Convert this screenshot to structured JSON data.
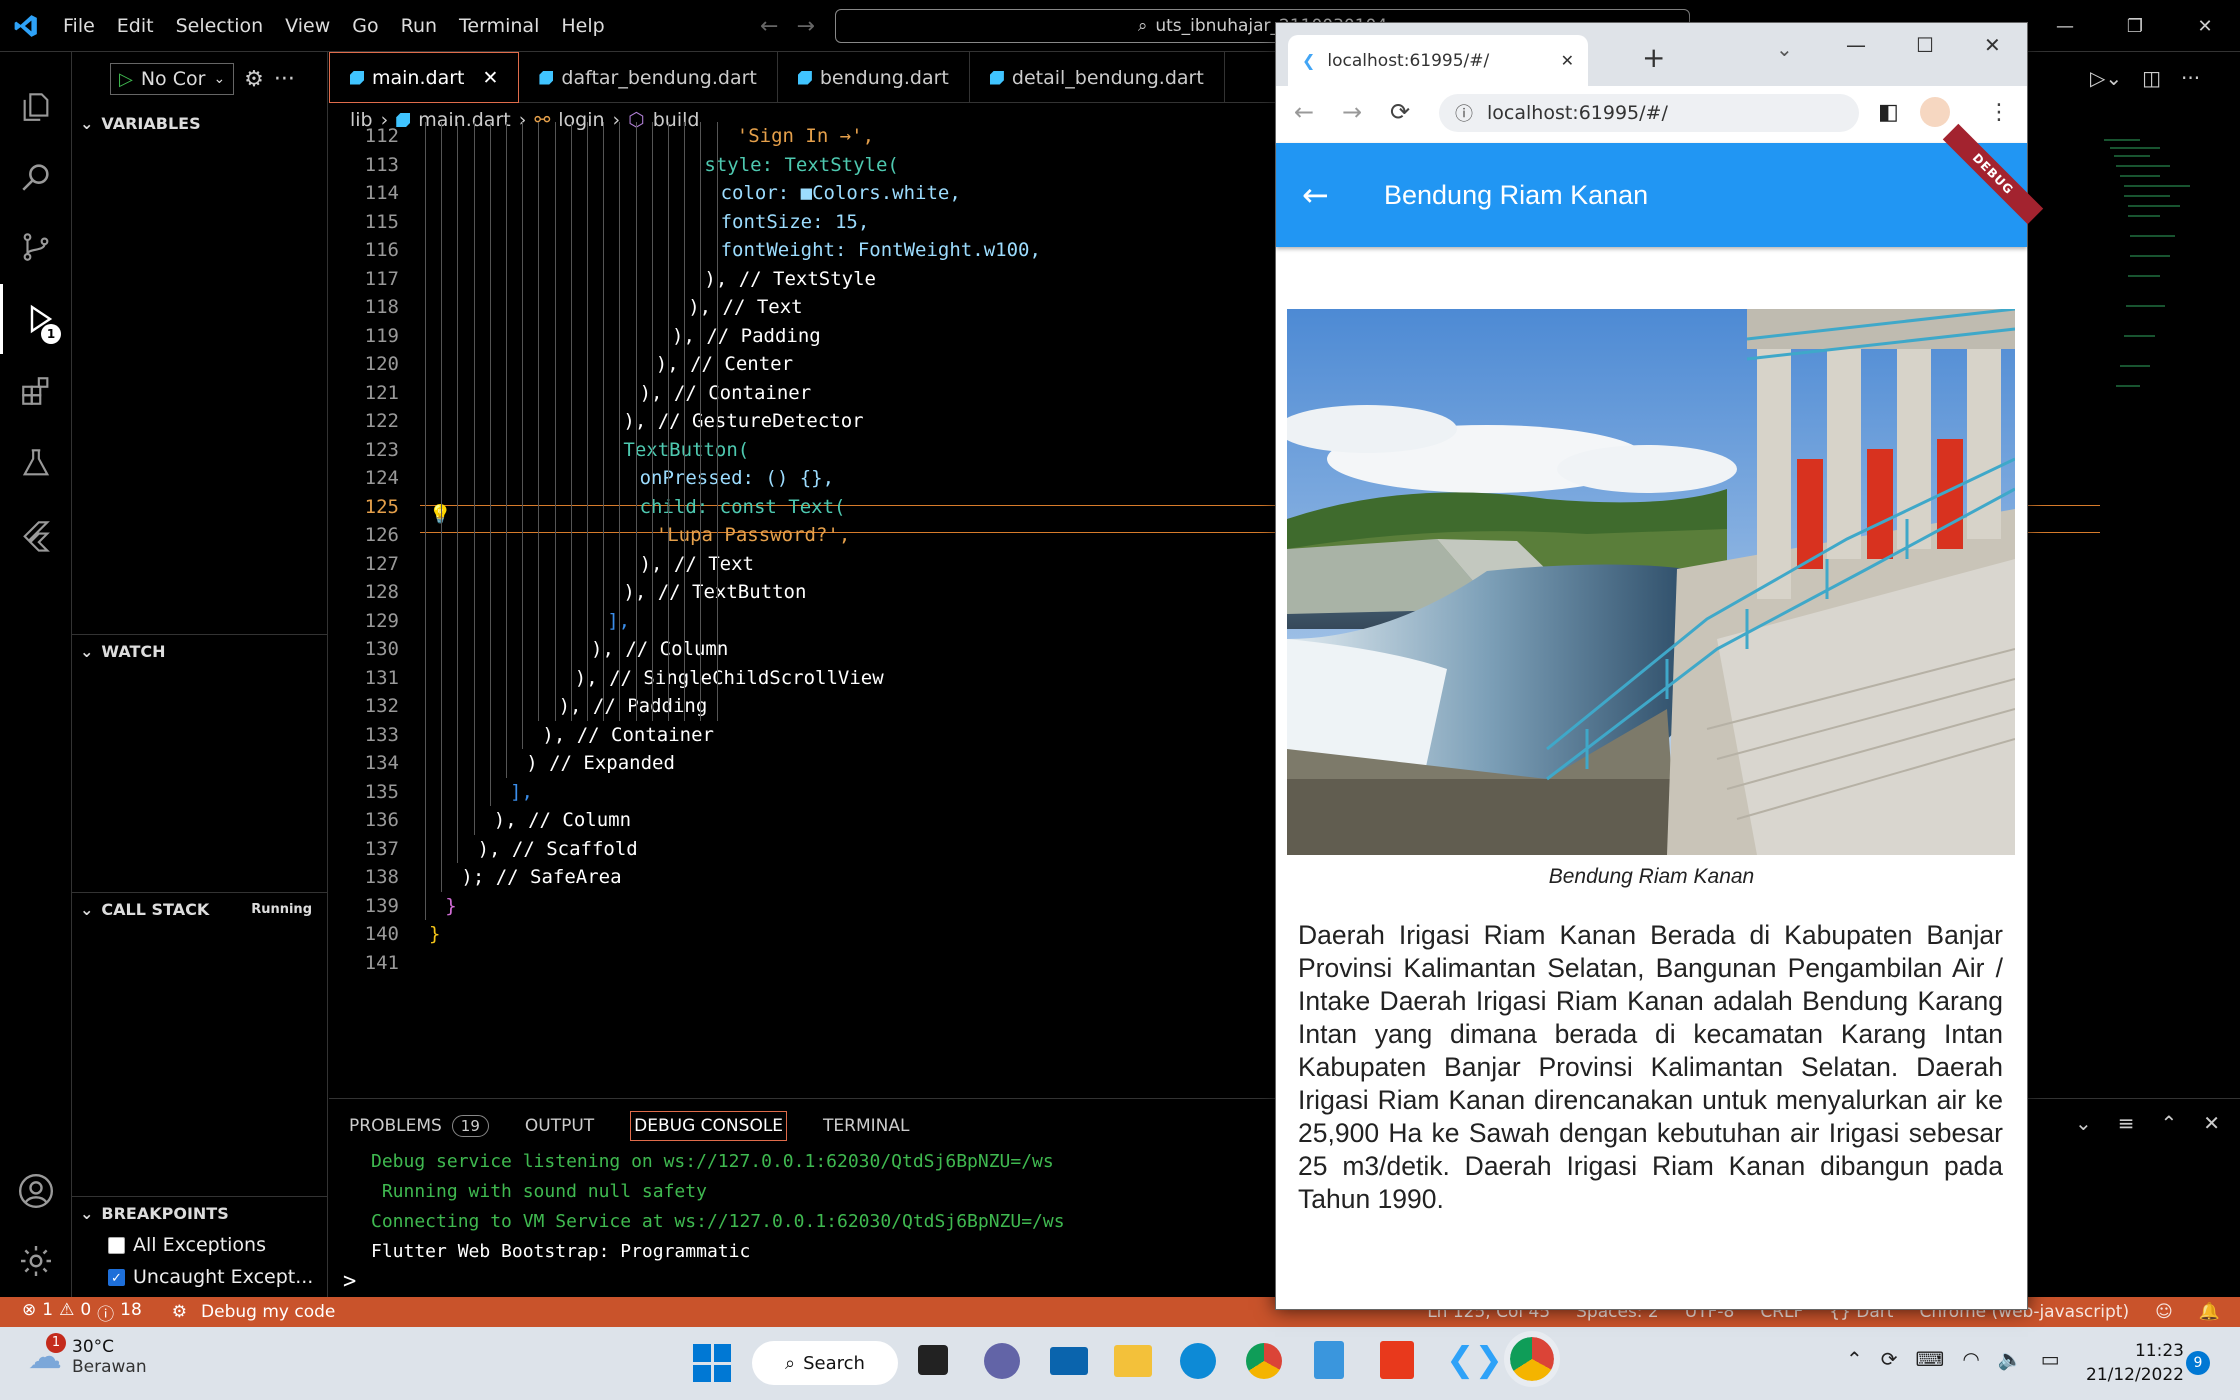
{
  "titlebar": {
    "menu": [
      "File",
      "Edit",
      "Selection",
      "View",
      "Go",
      "Run",
      "Terminal",
      "Help"
    ],
    "command_center": "uts_ibnuhajar_2110030104"
  },
  "sidebar": {
    "config": "No Cor",
    "variables": "VARIABLES",
    "watch": "WATCH",
    "call_stack": "CALL STACK",
    "call_stack_status": "Running",
    "breakpoints": "BREAKPOINTS",
    "bp_all": "All Exceptions",
    "bp_uncaught": "Uncaught Except...",
    "activity_badge": "1"
  },
  "tabs": [
    "main.dart",
    "daftar_bendung.dart",
    "bendung.dart",
    "detail_bendung.dart"
  ],
  "breadcrumb": [
    "lib",
    "main.dart",
    "login",
    "build"
  ],
  "code": {
    "lines": [
      {
        "n": "112",
        "t": "'Sign In →',"
      },
      {
        "n": "113",
        "t": "style: TextStyle("
      },
      {
        "n": "114",
        "t": "color: ■Colors.white,"
      },
      {
        "n": "115",
        "t": "fontSize: 15,"
      },
      {
        "n": "116",
        "t": "fontWeight: FontWeight.w100,"
      },
      {
        "n": "117",
        "t": "), // TextStyle"
      },
      {
        "n": "118",
        "t": "), // Text"
      },
      {
        "n": "119",
        "t": "), // Padding"
      },
      {
        "n": "120",
        "t": "), // Center"
      },
      {
        "n": "121",
        "t": "), // Container"
      },
      {
        "n": "122",
        "t": "), // GestureDetector"
      },
      {
        "n": "123",
        "t": "TextButton("
      },
      {
        "n": "124",
        "t": "onPressed: () {},"
      },
      {
        "n": "125",
        "t": "child: const Text("
      },
      {
        "n": "126",
        "t": "'Lupa Password?',"
      },
      {
        "n": "127",
        "t": "), // Text"
      },
      {
        "n": "128",
        "t": "), // TextButton"
      },
      {
        "n": "129",
        "t": "],"
      },
      {
        "n": "130",
        "t": "), // Column"
      },
      {
        "n": "131",
        "t": "), // SingleChildScrollView"
      },
      {
        "n": "132",
        "t": "), // Padding"
      },
      {
        "n": "133",
        "t": "), // Container"
      },
      {
        "n": "134",
        "t": ") // Expanded"
      },
      {
        "n": "135",
        "t": "],"
      },
      {
        "n": "136",
        "t": "), // Column"
      },
      {
        "n": "137",
        "t": "), // Scaffold"
      },
      {
        "n": "138",
        "t": "); // SafeArea"
      },
      {
        "n": "139",
        "t": "}"
      },
      {
        "n": "140",
        "t": "}"
      },
      {
        "n": "141",
        "t": ""
      }
    ]
  },
  "panel": {
    "tabs": [
      "PROBLEMS",
      "OUTPUT",
      "DEBUG CONSOLE",
      "TERMINAL"
    ],
    "problems_count": "19",
    "console": [
      "Debug service listening on ws://127.0.0.1:62030/QtdSj6BpNZU=/ws",
      " Running with sound null safety",
      "Connecting to VM Service at ws://127.0.0.1:62030/QtdSj6BpNZU=/ws",
      "Flutter Web Bootstrap: Programmatic"
    ],
    "prompt": ">"
  },
  "statusbar": {
    "errors": "1",
    "warnings": "0",
    "info": "18",
    "debug": "Debug my code",
    "position": "Ln 125, Col 45",
    "spaces": "Spaces: 2",
    "encoding": "UTF-8",
    "eol": "CRLF",
    "language": "{} Dart",
    "device": "Chrome (web-javascript)"
  },
  "browser": {
    "tab_title": "localhost:61995/#/",
    "url": "localhost:61995/#/",
    "app_title": "Bendung Riam Kanan",
    "debug_banner": "DEBUG",
    "caption": "Bendung Riam Kanan",
    "description": "Daerah Irigasi Riam Kanan Berada di Kabupaten Banjar Provinsi Kalimantan Selatan, Bangunan Pengambilan Air / Intake  Daerah Irigasi Riam Kanan adalah Bendung Karang Intan yang dimana berada di kecamatan Karang Intan Kabupaten Banjar Provinsi Kalimantan Selatan. Daerah Irigasi Riam Kanan direncanakan untuk menyalurkan air ke 25,900 Ha ke Sawah dengan kebutuhan air Irigasi sebesar 25 m3/detik. Daerah Irigasi Riam Kanan dibangun pada Tahun 1990."
  },
  "taskbar": {
    "weather_temp": "30°C",
    "weather_desc": "Berawan",
    "weather_badge": "1",
    "search": "Search",
    "time": "11:23",
    "date": "21/12/2022",
    "notif_count": "9"
  },
  "colors": {
    "accent": "#2196f3",
    "status": "#c9532b",
    "debug_ribbon": "#a3232f"
  }
}
